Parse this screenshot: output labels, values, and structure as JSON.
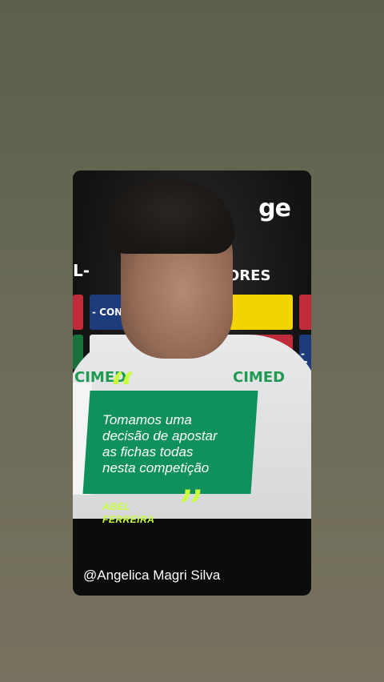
{
  "story": {
    "brand": "ge",
    "backdrop_texts": [
      "L-",
      "ORES",
      "- CONMEB",
      "- C",
      "CIMED",
      "CIMED"
    ],
    "quote_marks": {
      "open": "“",
      "close": "”"
    },
    "quote_lines": [
      "Tomamos uma",
      "decisão de apostar",
      "as fichas todas",
      "nesta competição"
    ],
    "speaker_lines": [
      "ABEL",
      "FERREIRA"
    ],
    "username": "@Angelica Magri Silva"
  },
  "colors": {
    "page_background": "#6a6a56",
    "quote_box": "#10905a",
    "accent": "#c9ff3b",
    "text": "#ffffff"
  }
}
